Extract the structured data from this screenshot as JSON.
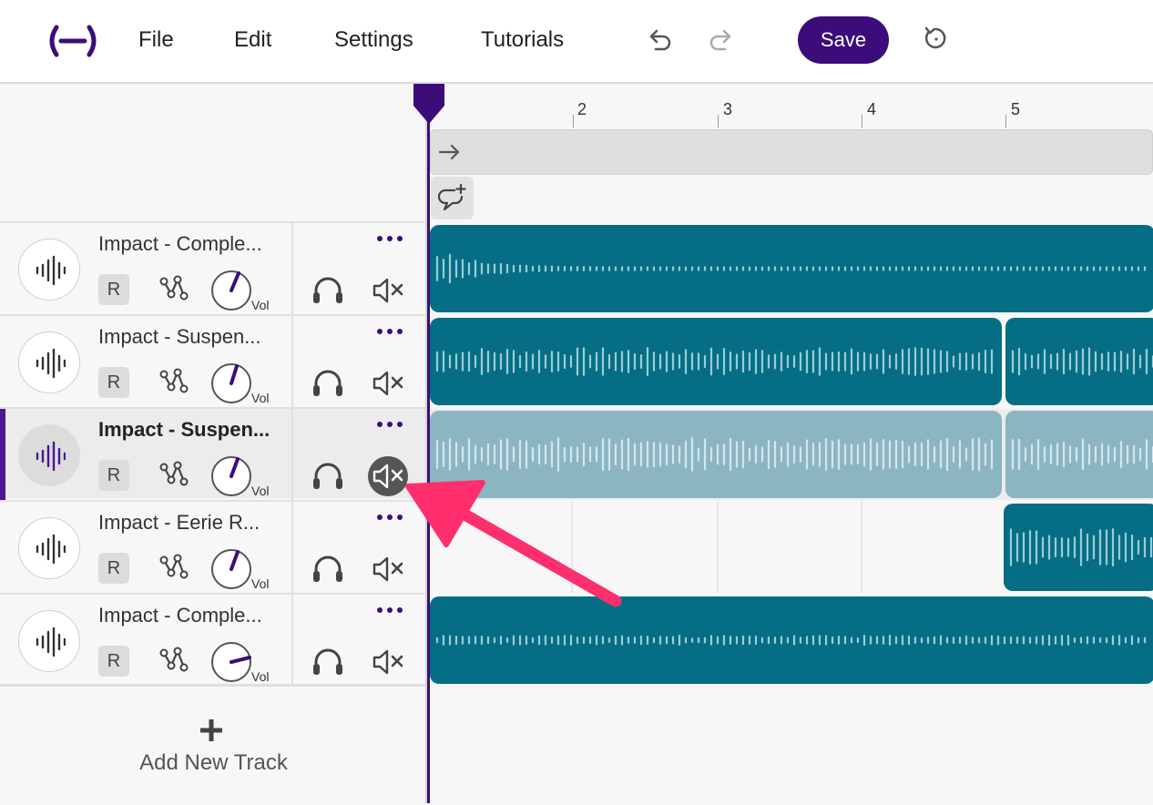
{
  "menu": {
    "file": "File",
    "edit": "Edit",
    "settings": "Settings",
    "tutorials": "Tutorials"
  },
  "toolbar": {
    "save_label": "Save"
  },
  "colors": {
    "accent": "#3c0d7a",
    "clip": "#056e85",
    "clip_muted": "#8cb5c2",
    "annotation": "#ff2f6e"
  },
  "ruler": {
    "ticks": [
      "2",
      "3",
      "4",
      "5"
    ]
  },
  "tracks": [
    {
      "name": "Impact - Comple...",
      "r": "R",
      "vol": "Vol",
      "muted": false,
      "selected": false
    },
    {
      "name": "Impact - Suspen...",
      "r": "R",
      "vol": "Vol",
      "muted": false,
      "selected": false
    },
    {
      "name": "Impact - Suspen...",
      "r": "R",
      "vol": "Vol",
      "muted": true,
      "selected": true
    },
    {
      "name": "Impact - Eerie R...",
      "r": "R",
      "vol": "Vol",
      "muted": false,
      "selected": false
    },
    {
      "name": "Impact - Comple...",
      "r": "R",
      "vol": "Vol",
      "muted": false,
      "selected": false
    }
  ],
  "add_track": {
    "label": "Add New Track"
  }
}
